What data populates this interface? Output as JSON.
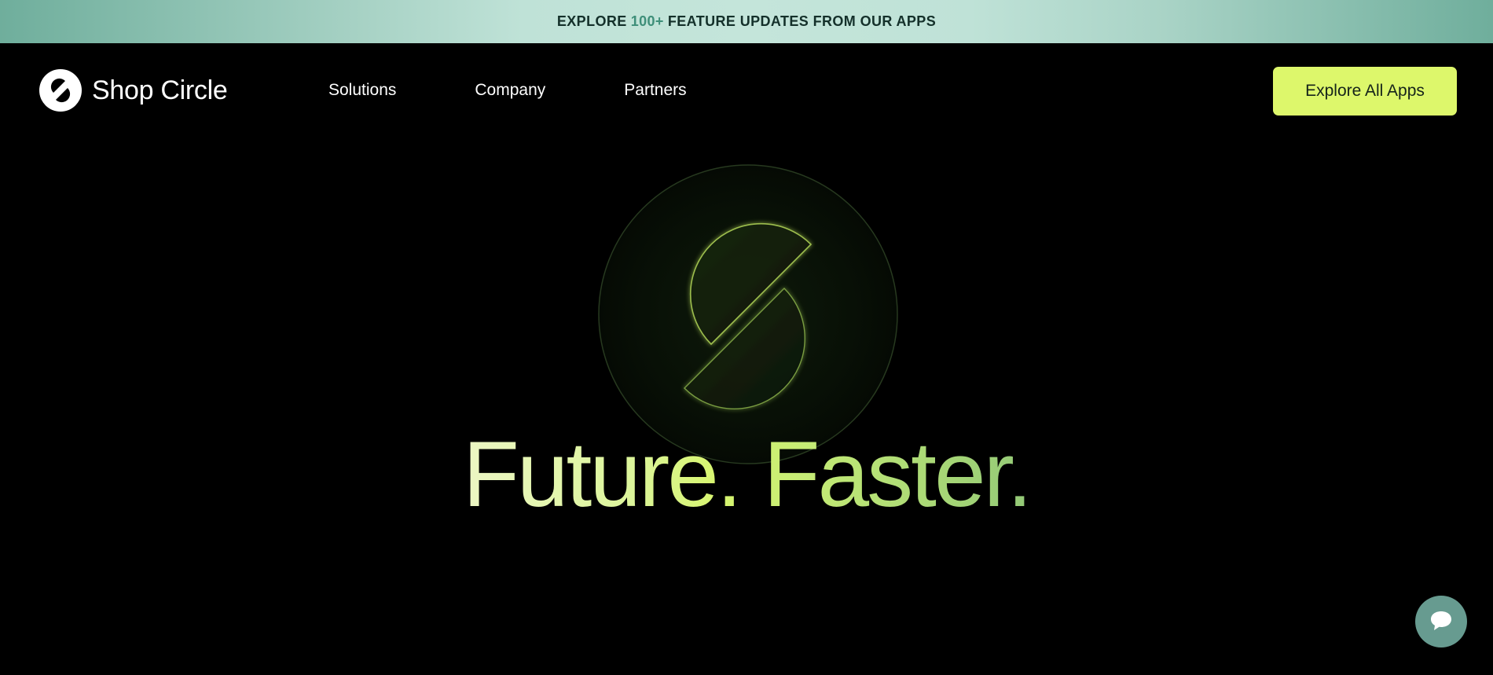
{
  "announcement": {
    "prefix": "EXPLORE",
    "highlight": "100+",
    "suffix": "FEATURE UPDATES FROM OUR APPS",
    "highlight_color": "#3e8f79"
  },
  "brand": {
    "name": "Shop Circle",
    "logo_icon": "shop-circle-logo-icon"
  },
  "nav": {
    "links": [
      {
        "label": "Solutions"
      },
      {
        "label": "Company"
      },
      {
        "label": "Partners"
      }
    ],
    "cta_label": "Explore All Apps",
    "cta_color": "#ddf76b"
  },
  "hero": {
    "title": "Future. Faster.",
    "emblem_icon": "shop-circle-emblem-icon"
  },
  "chat": {
    "icon": "chat-bubble-icon",
    "color": "#679b90"
  }
}
